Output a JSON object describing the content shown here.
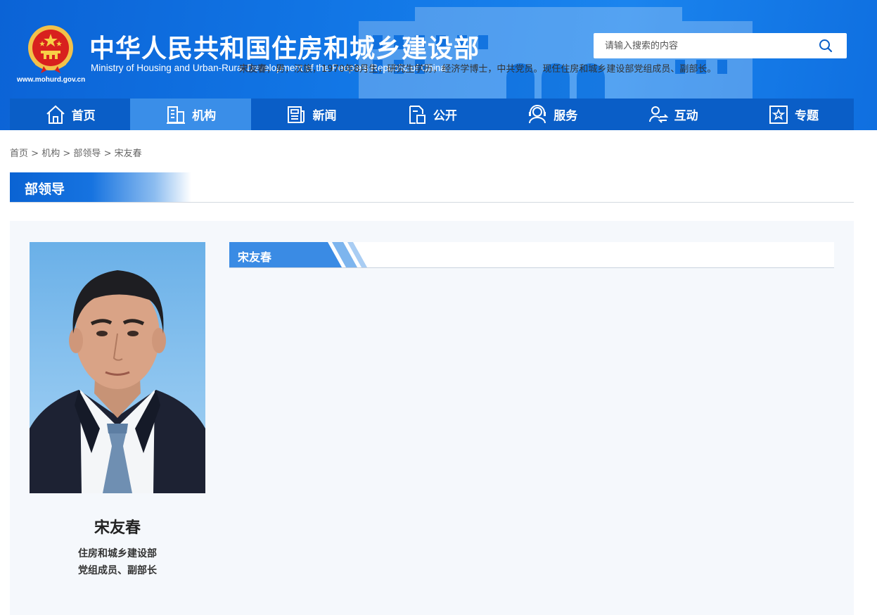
{
  "header": {
    "title_cn": "中华人民共和国住房和城乡建设部",
    "title_en": "Ministry of Housing and Urban-Rural Development of the People’s Republic of China",
    "site_url": "www.mohurd.gov.cn",
    "search_placeholder": "请输入搜索的内容"
  },
  "nav": {
    "items": [
      {
        "label": "首页",
        "icon": "home-icon"
      },
      {
        "label": "机构",
        "icon": "building-icon"
      },
      {
        "label": "新闻",
        "icon": "news-icon"
      },
      {
        "label": "公开",
        "icon": "disclosure-icon"
      },
      {
        "label": "服务",
        "icon": "service-icon"
      },
      {
        "label": "互动",
        "icon": "interaction-icon"
      },
      {
        "label": "专题",
        "icon": "topic-icon"
      }
    ],
    "active_index": 1
  },
  "breadcrumb": {
    "items": [
      "首页",
      "机构",
      "部领导",
      "宋友春"
    ],
    "separator": ">"
  },
  "section": {
    "title": "部领导"
  },
  "profile": {
    "name": "宋友春",
    "org": "住房和城乡建设部",
    "title": "党组成员、副部长",
    "bio_name": "宋友春",
    "bio_text": "，男，汉族，1970年8月生，研究生学历，经济学博士，中共党员。现任住房和城乡建设部党组成员、副部长。"
  },
  "colors": {
    "brand_blue": "#0a5ec7",
    "active_nav": "#3a8ee8",
    "panel_bg": "#f5f8fc"
  }
}
